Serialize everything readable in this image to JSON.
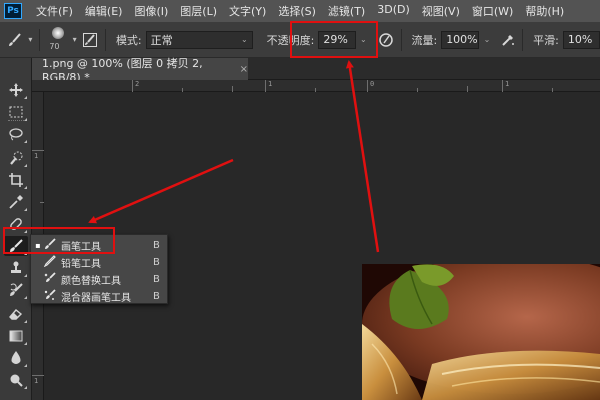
{
  "app": {
    "logo": "Ps"
  },
  "menubar": {
    "items": [
      "文件(F)",
      "编辑(E)",
      "图像(I)",
      "图层(L)",
      "文字(Y)",
      "选择(S)",
      "滤镜(T)",
      "3D(D)",
      "视图(V)",
      "窗口(W)",
      "帮助(H)"
    ]
  },
  "options": {
    "brush_size": "70",
    "mode_label": "模式:",
    "mode_value": "正常",
    "opacity_label": "不透明度:",
    "opacity_value": "29%",
    "flow_label": "流量:",
    "flow_value": "100%",
    "smooth_label": "平滑:",
    "smooth_value": "10%"
  },
  "document": {
    "tab_title": "1.png @ 100% (图层 0 拷贝 2, RGB/8) *",
    "close_glyph": "×"
  },
  "rulers": {
    "h_labels": [
      "2",
      "1",
      "0",
      "1"
    ],
    "v_labels": [
      "1",
      "1"
    ]
  },
  "flyout": {
    "items": [
      {
        "name": "画笔工具",
        "key": "B",
        "selected": true,
        "icon": "brush-icon"
      },
      {
        "name": "铅笔工具",
        "key": "B",
        "selected": false,
        "icon": "pencil-icon"
      },
      {
        "name": "颜色替换工具",
        "key": "B",
        "selected": false,
        "icon": "color-replacement-icon"
      },
      {
        "name": "混合器画笔工具",
        "key": "B",
        "selected": false,
        "icon": "mixer-brush-icon"
      }
    ],
    "selected_mark": "▪"
  },
  "annotation_color": "#e01010"
}
